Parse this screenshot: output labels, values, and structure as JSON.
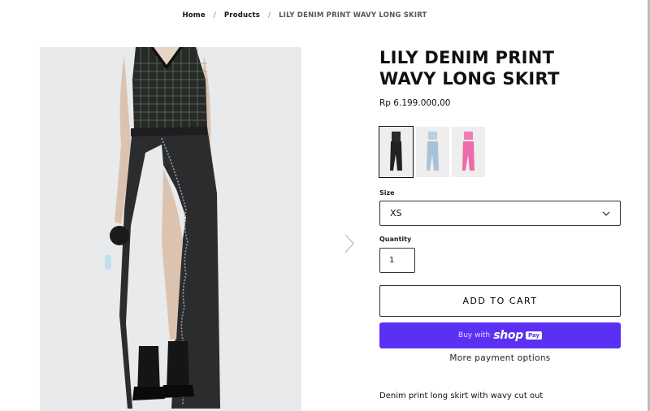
{
  "breadcrumb": {
    "items": [
      "Home",
      "Products"
    ],
    "separator": "/",
    "current": "LILY DENIM PRINT WAVY LONG SKIRT"
  },
  "gallery": {
    "image_alt": "model wearing black denim print wavy long skirt with checkered knit vest",
    "next_icon": "chevron-right-icon"
  },
  "product": {
    "title": "LILY DENIM PRINT WAVY LONG SKIRT",
    "price": "Rp 6.199.000,00",
    "variants": [
      {
        "color": "black",
        "selected": true
      },
      {
        "color": "light blue",
        "selected": false
      },
      {
        "color": "pink",
        "selected": false
      }
    ],
    "size_label": "Size",
    "size_value": "XS",
    "quantity_label": "Quantity",
    "quantity_value": "1",
    "add_to_cart_label": "ADD TO CART",
    "shop_pay": {
      "buy_with": "Buy with",
      "shop": "shop",
      "pay": "Pay"
    },
    "more_payment_label": "More payment options",
    "description": "Denim print long skirt with wavy cut out"
  },
  "colors": {
    "shop_pay": "#5a31f4",
    "text": "#111111",
    "image_bg": "#e9eaeb"
  }
}
